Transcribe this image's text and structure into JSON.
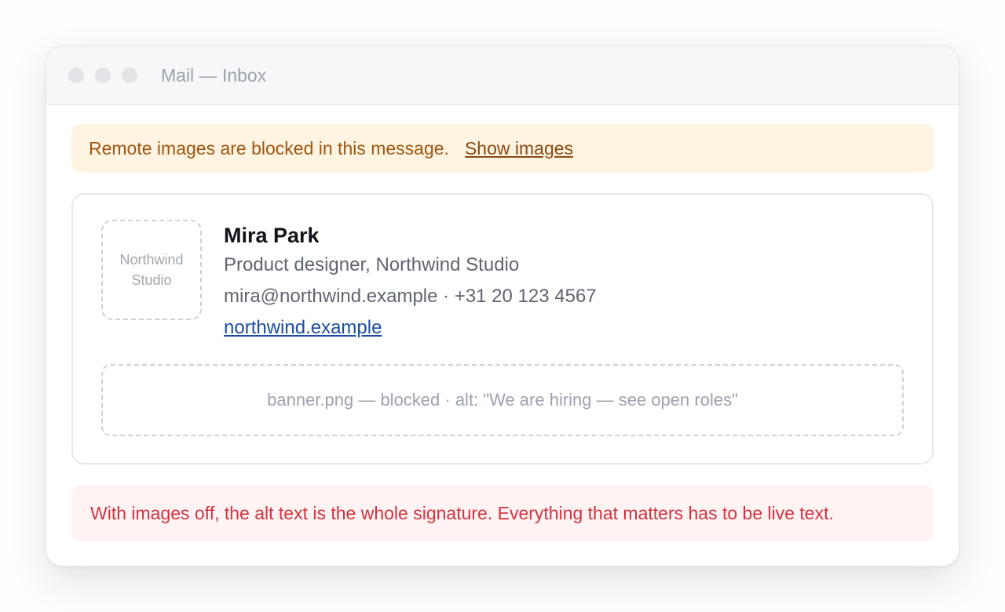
{
  "window": {
    "title": "Mail — Inbox"
  },
  "notice": {
    "text": "Remote images are blocked in this message.",
    "link_label": "Show images"
  },
  "signature": {
    "logo_alt": "Northwind\nStudio",
    "name": "Mira Park",
    "role": "Product designer, Northwind Studio",
    "contact": "mira@northwind.example · +31 20 123 4567",
    "website": "northwind.example",
    "banner_placeholder": "banner.png — blocked · alt: \"We are hiring — see open roles\""
  },
  "warning": {
    "text": "With images off, the alt text is the whole signature. Everything that matters has to be live text."
  },
  "colors": {
    "notice_bg": "#fff3e2",
    "notice_text": "#a0560f",
    "warning_bg": "#fff3f4",
    "warning_text": "#d2343f",
    "link": "#1d4ea3"
  }
}
